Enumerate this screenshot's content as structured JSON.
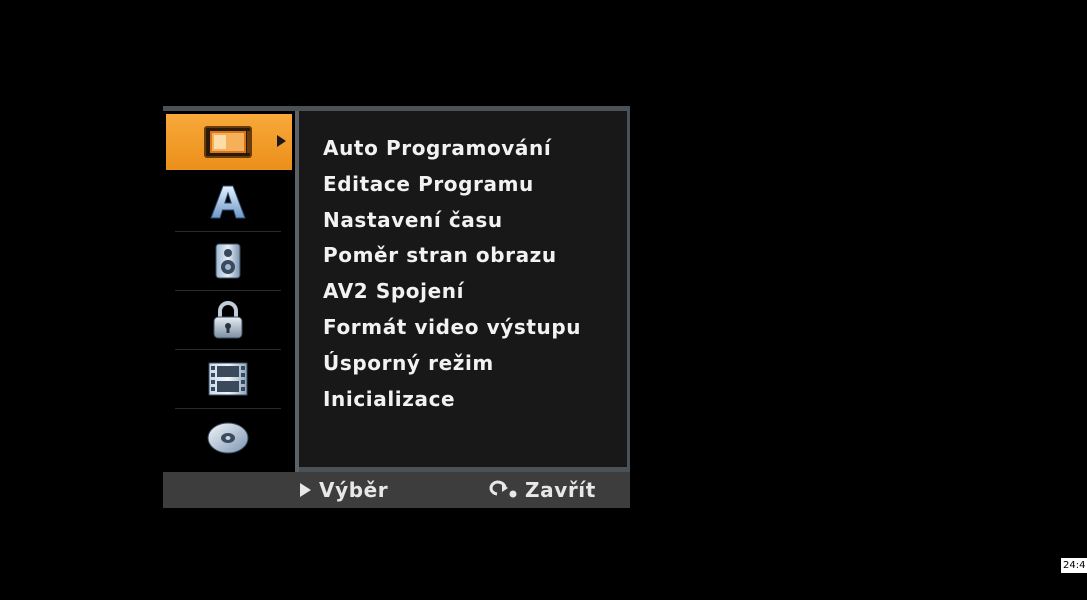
{
  "sidebar": {
    "items": [
      {
        "icon": "tv-screen-icon",
        "active": true
      },
      {
        "icon": "letter-a-icon",
        "active": false
      },
      {
        "icon": "speaker-icon",
        "active": false
      },
      {
        "icon": "lock-icon",
        "active": false
      },
      {
        "icon": "film-strip-icon",
        "active": false
      },
      {
        "icon": "disc-icon",
        "active": false
      }
    ]
  },
  "menu": {
    "items": [
      "Auto Programování",
      "Editace Programu",
      "Nastavení času",
      "Poměr stran obrazu",
      "AV2 Spojení",
      "Formát video výstupu",
      "Úsporný režim",
      "Inicializace"
    ]
  },
  "footer": {
    "select_label": "Výběr",
    "close_label": "Zavřít"
  },
  "clock": {
    "text": "24:4"
  },
  "colors": {
    "accent": "#f2a033",
    "background": "#000000",
    "panel": "#181818",
    "footer": "#3d3d3d",
    "text": "#f2f2f2"
  }
}
